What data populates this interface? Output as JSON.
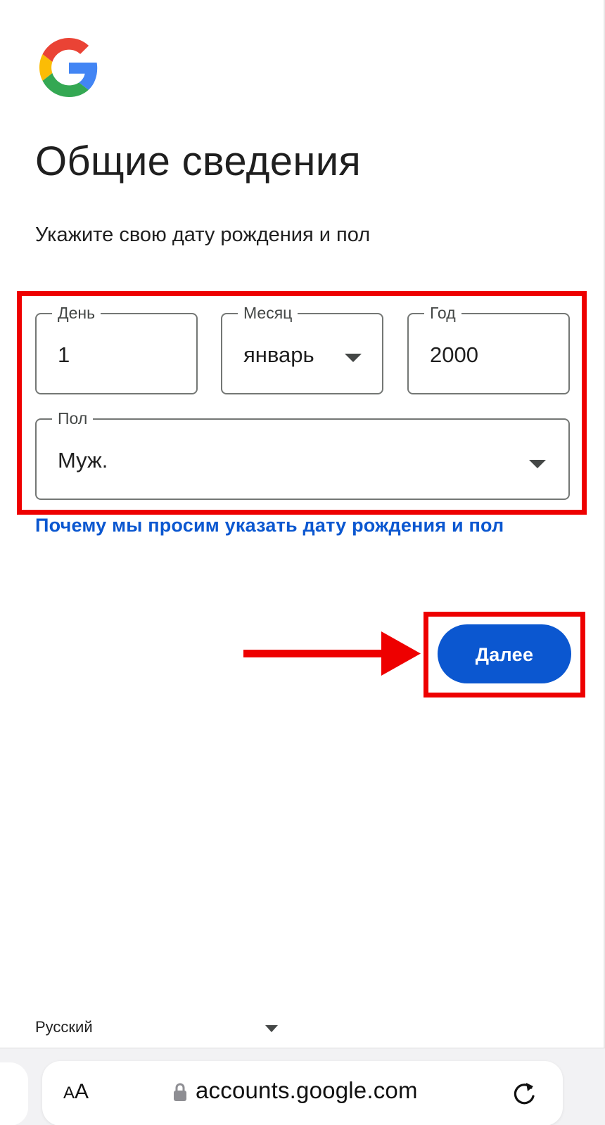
{
  "header": {
    "logo_icon": "google-g-logo",
    "title": "Общие сведения",
    "subtitle": "Укажите свою дату рождения и пол"
  },
  "form": {
    "day": {
      "label": "День",
      "value": "1"
    },
    "month": {
      "label": "Месяц",
      "value": "январь"
    },
    "year": {
      "label": "Год",
      "value": "2000"
    },
    "gender": {
      "label": "Пол",
      "value": "Муж."
    },
    "why_link": "Почему мы просим указать дату рождения и пол",
    "next_label": "Далее"
  },
  "footer": {
    "language": "Русский"
  },
  "browser": {
    "text_size_label_small": "A",
    "text_size_label_large": "A",
    "url": "accounts.google.com"
  },
  "colors": {
    "primary": "#0b57d0",
    "annotation": "#ee0000",
    "text": "#1f1f1f",
    "outline": "#747775"
  }
}
